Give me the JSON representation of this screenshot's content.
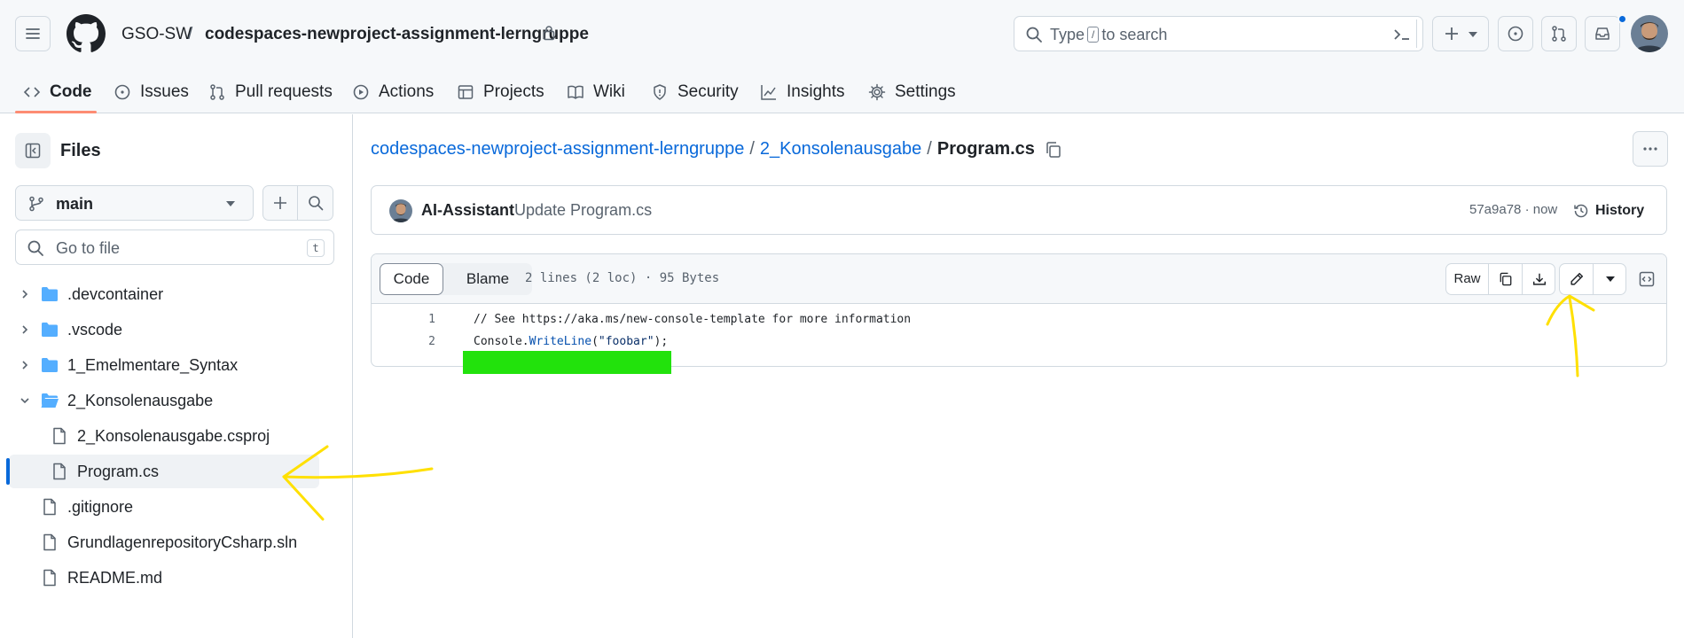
{
  "header": {
    "owner": "GSO-SW",
    "separator": "/",
    "repo": "codespaces-newproject-assignment-lerngruppe",
    "search": {
      "prefix": "Type",
      "key": "/",
      "suffix": "to search"
    }
  },
  "nav": {
    "tabs": [
      {
        "label": "Code",
        "icon": "code-icon"
      },
      {
        "label": "Issues",
        "icon": "issue-icon"
      },
      {
        "label": "Pull requests",
        "icon": "pull-request-icon"
      },
      {
        "label": "Actions",
        "icon": "play-icon"
      },
      {
        "label": "Projects",
        "icon": "table-icon"
      },
      {
        "label": "Wiki",
        "icon": "book-icon"
      },
      {
        "label": "Security",
        "icon": "shield-icon"
      },
      {
        "label": "Insights",
        "icon": "graph-icon"
      },
      {
        "label": "Settings",
        "icon": "gear-icon"
      }
    ],
    "active": "Code"
  },
  "sidebar": {
    "title": "Files",
    "branch": "main",
    "goto_placeholder": "Go to file",
    "goto_key": "t",
    "tree": [
      {
        "label": ".devcontainer",
        "type": "folder",
        "expanded": false
      },
      {
        "label": ".vscode",
        "type": "folder",
        "expanded": false
      },
      {
        "label": "1_Emelmentare_Syntax",
        "type": "folder",
        "expanded": false
      },
      {
        "label": "2_Konsolenausgabe",
        "type": "folder",
        "expanded": true
      },
      {
        "label": "2_Konsolenausgabe.csproj",
        "type": "file",
        "nested": true
      },
      {
        "label": "Program.cs",
        "type": "file",
        "nested": true,
        "selected": true
      },
      {
        "label": ".gitignore",
        "type": "file"
      },
      {
        "label": "GrundlagenrepositoryCsharp.sln",
        "type": "file"
      },
      {
        "label": "README.md",
        "type": "file"
      }
    ]
  },
  "main": {
    "path": {
      "repo": "codespaces-newproject-assignment-lerngruppe",
      "folder": "2_Konsolenausgabe",
      "file": "Program.cs",
      "sep": "/"
    },
    "commit": {
      "author": "AI-Assistant",
      "message": "Update Program.cs",
      "meta": "57a9a78 · now",
      "history_label": "History"
    },
    "file": {
      "tab_code": "Code",
      "tab_blame": "Blame",
      "info": "2 lines (2 loc) · 95 Bytes",
      "raw_label": "Raw",
      "lines": [
        {
          "num": "1",
          "comment": "// See https://aka.ms/new-console-template for more information"
        },
        {
          "num": "2",
          "prefix": "Console.",
          "method": "WriteLine",
          "open": "(",
          "string": "\"foobar\"",
          "close": ");"
        }
      ]
    }
  },
  "colors": {
    "accent": "#0969da",
    "nav_underline": "#fd8c73",
    "highlight_mark": "#22e20c",
    "annotation": "#ffe000"
  }
}
